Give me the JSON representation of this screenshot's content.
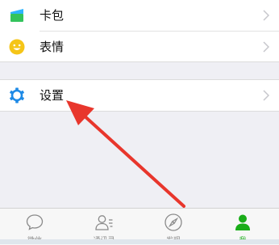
{
  "menu": {
    "items": [
      {
        "label": "卡包",
        "icon": "card-wallet-icon"
      },
      {
        "label": "表情",
        "icon": "smiley-face-icon"
      },
      {
        "label": "设置",
        "icon": "gear-icon"
      }
    ]
  },
  "tabbar": {
    "tabs": [
      {
        "label": "微信",
        "icon": "chat-bubble-icon",
        "active": false
      },
      {
        "label": "通讯录",
        "icon": "contacts-icon",
        "active": false
      },
      {
        "label": "发现",
        "icon": "compass-icon",
        "active": false
      },
      {
        "label": "我",
        "icon": "person-icon",
        "active": true
      }
    ]
  },
  "colors": {
    "accent_green": "#1aad19",
    "settings_icon_blue": "#1e8ae6",
    "emoji_yellow": "#f5c518",
    "annotation_red": "#e8362c"
  }
}
